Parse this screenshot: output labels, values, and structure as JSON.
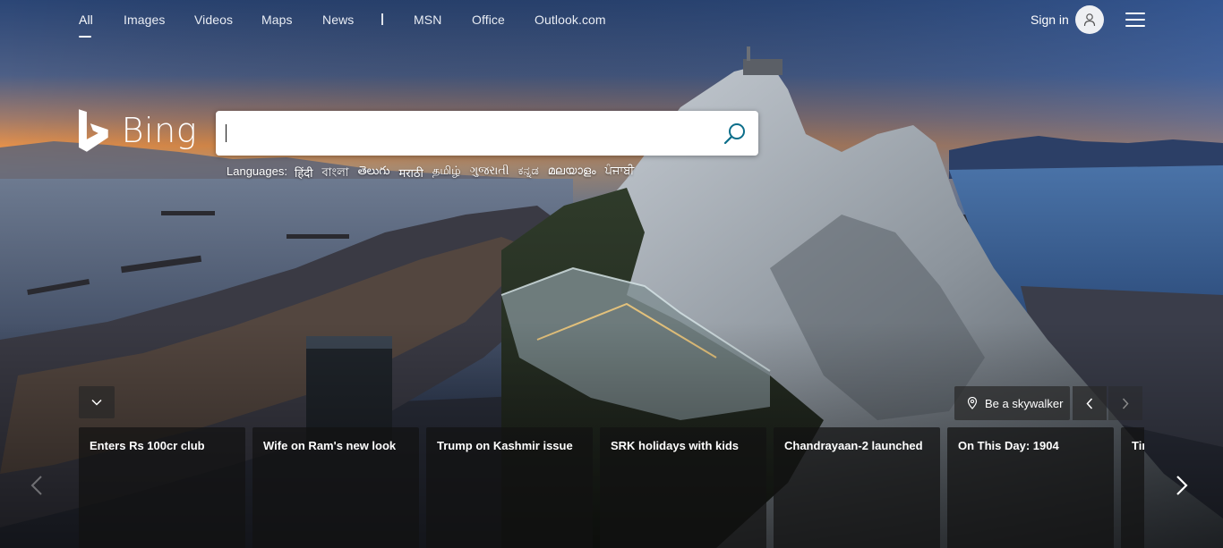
{
  "nav": {
    "items": [
      {
        "label": "All"
      },
      {
        "label": "Images"
      },
      {
        "label": "Videos"
      },
      {
        "label": "Maps"
      },
      {
        "label": "News"
      },
      {
        "label": "MSN"
      },
      {
        "label": "Office"
      },
      {
        "label": "Outlook.com"
      }
    ],
    "signin": "Sign in"
  },
  "logo": {
    "text": "Bing"
  },
  "search": {
    "value": "",
    "placeholder": ""
  },
  "languages": {
    "label": "Languages:",
    "items": [
      "हिंदी",
      "বাংলা",
      "తెలుగు",
      "मराठी",
      "தமிழ்",
      "ગુજરાતી",
      "ಕನ್ನಡ",
      "മലയാളം",
      "ਪੰਜਾਬੀ"
    ]
  },
  "image_info": {
    "label": "Be a skywalker"
  },
  "news": {
    "cards": [
      {
        "title": "Enters Rs 100cr club"
      },
      {
        "title": "Wife on Ram's new look"
      },
      {
        "title": "Trump on Kashmir issue"
      },
      {
        "title": "SRK holidays with kids"
      },
      {
        "title": "Chandrayaan-2 launched"
      },
      {
        "title": "On This Day: 1904"
      },
      {
        "title": "Tir"
      }
    ]
  },
  "icons": {
    "user": "user-icon",
    "menu": "hamburger-icon",
    "search": "search-icon",
    "logo": "bing-logo-icon",
    "location": "location-pin-icon",
    "collapse": "chevron-down-icon",
    "prev": "chevron-left-icon",
    "next": "chevron-right-icon"
  },
  "colors": {
    "search_icon": "#0c6e8a",
    "card_bg": "#121212",
    "sky_top": "#2c4a78",
    "sunset": "#e8914a"
  }
}
